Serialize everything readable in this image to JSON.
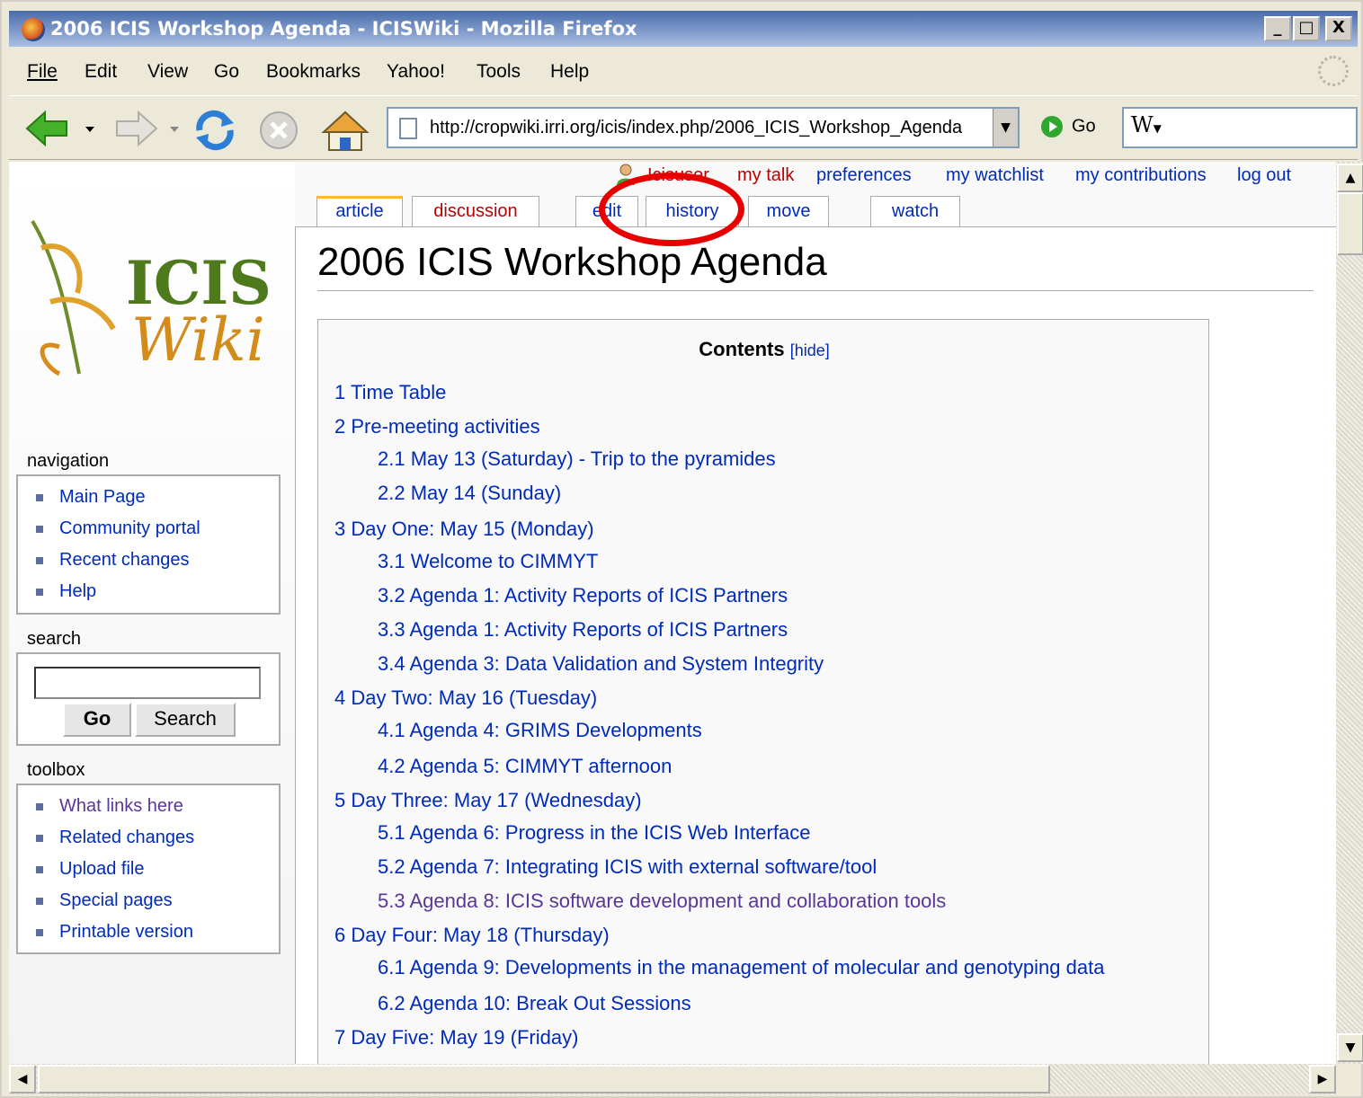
{
  "window": {
    "title": "2006 ICIS Workshop Agenda - ICISWiki - Mozilla Firefox",
    "min": "_",
    "max": "□",
    "close": "X"
  },
  "menu": [
    "File",
    "Edit",
    "View",
    "Go",
    "Bookmarks",
    "Yahoo!",
    "Tools",
    "Help"
  ],
  "toolbar": {
    "url": "http://cropwiki.irri.org/icis/index.php/2006_ICIS_Workshop_Agenda",
    "go_label": "Go",
    "search_engine_glyph": "W"
  },
  "personal": {
    "user": "Icisuser",
    "links": [
      "my talk",
      "preferences",
      "my watchlist",
      "my contributions",
      "log out"
    ]
  },
  "tabs": [
    "article",
    "discussion",
    "edit",
    "history",
    "move",
    "watch"
  ],
  "logo": {
    "line1": "ICIS",
    "line2": "Wiki"
  },
  "sidebar": {
    "navigation_title": "navigation",
    "navigation": [
      "Main Page",
      "Community portal",
      "Recent changes",
      "Help"
    ],
    "search_title": "search",
    "search_go": "Go",
    "search_search": "Search",
    "search_value": "",
    "toolbox_title": "toolbox",
    "toolbox": [
      "What links here",
      "Related changes",
      "Upload file",
      "Special pages",
      "Printable version"
    ]
  },
  "article": {
    "title": "2006 ICIS Workshop Agenda",
    "toc_title": "Contents",
    "toc_hide": "[hide]",
    "toc": [
      "1 Time Table",
      "2 Pre-meeting activities",
      "2.1 May 13 (Saturday) - Trip to the pyramides",
      "2.2 May 14 (Sunday)",
      "3 Day One: May 15 (Monday)",
      "3.1 Welcome to CIMMYT",
      "3.2 Agenda 1: Activity Reports of ICIS Partners",
      "3.3 Agenda 1: Activity Reports of ICIS Partners",
      "3.4 Agenda 3: Data Validation and System Integrity",
      "4 Day Two: May 16 (Tuesday)",
      "4.1 Agenda 4: GRIMS Developments",
      "4.2 Agenda 5: CIMMYT afternoon",
      "5 Day Three: May 17 (Wednesday)",
      "5.1 Agenda 6: Progress in the ICIS Web Interface",
      "5.2 Agenda 7: Integrating ICIS with external software/tool",
      "5.3 Agenda 8: ICIS software development and collaboration tools",
      "6 Day Four: May 18 (Thursday)",
      "6.1 Agenda 9: Developments in the management of molecular and genotyping data",
      "6.2 Agenda 10: Break Out Sessions",
      "7 Day Five: May 19 (Friday)"
    ]
  },
  "colors": {
    "link": "#002bb8",
    "visited": "#5a3696",
    "new_link": "#ba0000",
    "annotation": "#e80000",
    "selected_tab": "#fabd23"
  }
}
